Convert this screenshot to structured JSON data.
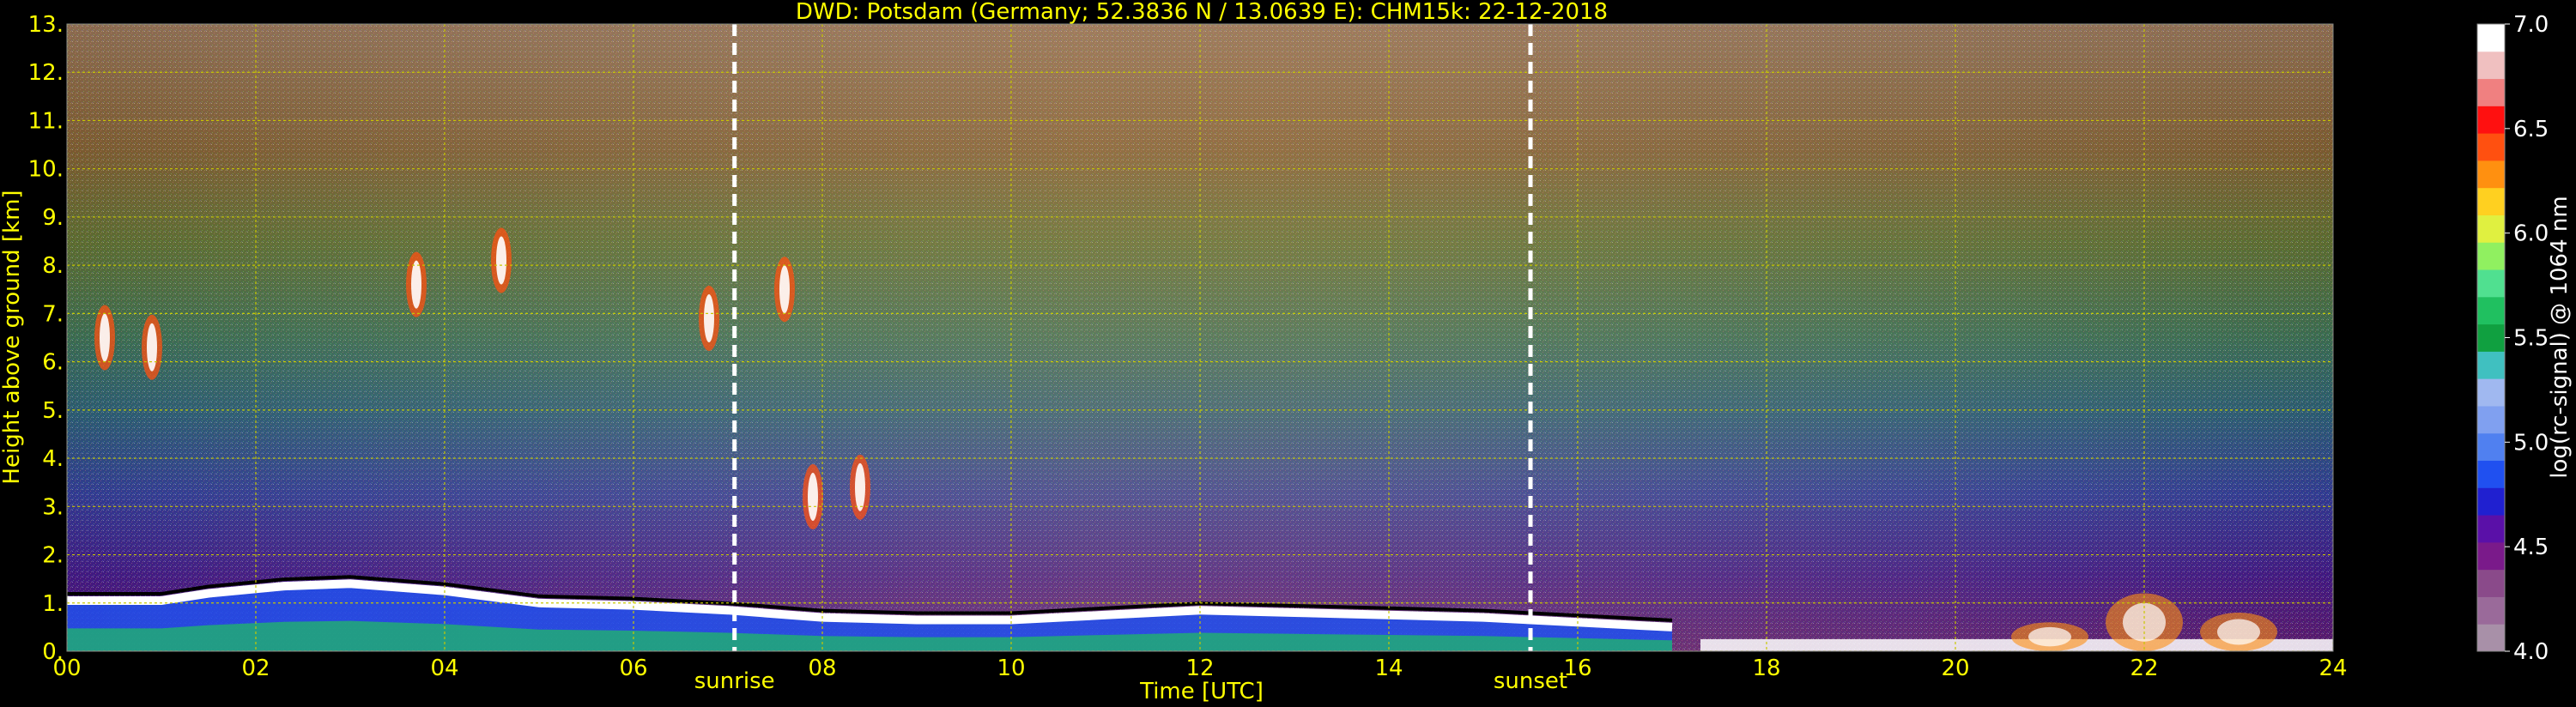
{
  "chart_data": {
    "type": "heatmap",
    "title": "DWD: Potsdam (Germany; 52.3836 N / 13.0639 E):    CHM15k: 22-12-2018",
    "xlabel": "Time [UTC]",
    "ylabel": "Height above ground [km]",
    "xlim": [
      0,
      24
    ],
    "ylim": [
      0,
      13
    ],
    "x_tick_values": [
      0,
      2,
      4,
      6,
      8,
      10,
      12,
      14,
      16,
      18,
      20,
      22,
      24
    ],
    "x_ticks": [
      "00",
      "02",
      "04",
      "06",
      "08",
      "10",
      "12",
      "14",
      "16",
      "18",
      "20",
      "22",
      "24"
    ],
    "y_tick_values": [
      0,
      1,
      2,
      3,
      4,
      5,
      6,
      7,
      8,
      9,
      10,
      11,
      12,
      13
    ],
    "y_ticks": [
      "0.",
      "1.",
      "2.",
      "3.",
      "4.",
      "5.",
      "6.",
      "7.",
      "8.",
      "9.",
      "10.",
      "11.",
      "12.",
      "13."
    ],
    "grid": true,
    "markers": [
      {
        "label": "sunrise",
        "time": 7.07
      },
      {
        "label": "sunset",
        "time": 15.5
      }
    ],
    "colorbar": {
      "label": "log(rc-signal) @ 1064 nm",
      "range": [
        4.0,
        7.0
      ],
      "tick_values": [
        4.0,
        4.5,
        5.0,
        5.5,
        6.0,
        6.5,
        7.0
      ],
      "ticks": [
        "4.0",
        "4.5",
        "5.0",
        "5.5",
        "6.0",
        "6.5",
        "7.0"
      ],
      "colors": [
        "#a890a8",
        "#9a6a9a",
        "#8a4a8a",
        "#7a1a8a",
        "#5a10a8",
        "#2020d0",
        "#2050f0",
        "#5080f0",
        "#80a0f0",
        "#a0b8f0",
        "#40c0c0",
        "#10a040",
        "#20c060",
        "#50e090",
        "#90f060",
        "#e0f040",
        "#ffd020",
        "#ff9010",
        "#ff5010",
        "#ff1010",
        "#f08080",
        "#f0c0c0",
        "#ffffff"
      ]
    },
    "cloud_base_layer": [
      {
        "time": 0.0,
        "height": 1.05
      },
      {
        "time": 1.0,
        "height": 1.05
      },
      {
        "time": 1.5,
        "height": 1.2
      },
      {
        "time": 2.3,
        "height": 1.35
      },
      {
        "time": 3.0,
        "height": 1.4
      },
      {
        "time": 4.0,
        "height": 1.25
      },
      {
        "time": 5.0,
        "height": 1.0
      },
      {
        "time": 6.0,
        "height": 0.95
      },
      {
        "time": 7.0,
        "height": 0.85
      },
      {
        "time": 8.0,
        "height": 0.7
      },
      {
        "time": 9.0,
        "height": 0.65
      },
      {
        "time": 10.0,
        "height": 0.65
      },
      {
        "time": 11.0,
        "height": 0.75
      },
      {
        "time": 12.0,
        "height": 0.85
      },
      {
        "time": 13.0,
        "height": 0.8
      },
      {
        "time": 14.0,
        "height": 0.75
      },
      {
        "time": 15.0,
        "height": 0.7
      },
      {
        "time": 16.0,
        "height": 0.6
      },
      {
        "time": 17.0,
        "height": 0.5
      }
    ],
    "aerosol_patches": [
      {
        "time": 22.0,
        "height": 1.2
      },
      {
        "time": 21.0,
        "height": 0.6
      },
      {
        "time": 23.0,
        "height": 0.8
      }
    ],
    "elevated_clouds": [
      {
        "time": 0.4,
        "height": 6.5
      },
      {
        "time": 0.9,
        "height": 6.3
      },
      {
        "time": 3.7,
        "height": 7.6
      },
      {
        "time": 4.6,
        "height": 8.1
      },
      {
        "time": 6.8,
        "height": 6.9
      },
      {
        "time": 7.6,
        "height": 7.5
      },
      {
        "time": 7.9,
        "height": 3.2
      },
      {
        "time": 8.4,
        "height": 3.4
      }
    ]
  }
}
